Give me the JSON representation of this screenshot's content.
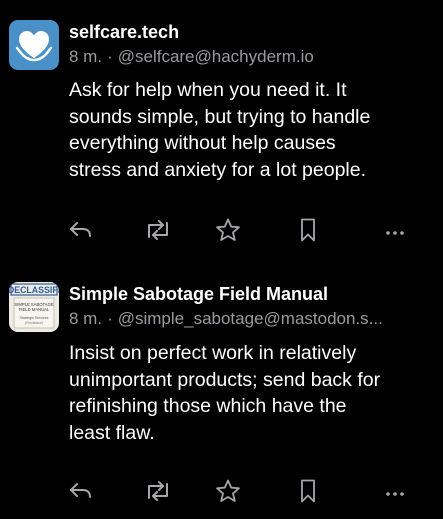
{
  "colors": {
    "background": "#000000",
    "text": "#ffffff",
    "meta_text": "#9a9aa0",
    "icon": "#a6a6ab",
    "selfcare_avatar_bg": "#4a90c8"
  },
  "posts": [
    {
      "display_name": "selfcare.tech",
      "time": "8 m.",
      "separator": "·",
      "handle": "@selfcare@hachyderm.io",
      "content_lines": [
        "Ask for help when you need it. It",
        "sounds simple, but trying to handle",
        "everything without help causes",
        "stress and anxiety for a lot people."
      ],
      "avatar_icon": "heart-hands-icon"
    },
    {
      "display_name": "Simple Sabotage Field Manual",
      "time": "8 m.",
      "separator": "·",
      "handle": "@simple_sabotage@mastodon.s...",
      "content_lines": [
        "Insist on perfect work in relatively",
        "unimportant products; send back for",
        "refinishing those which have the",
        "least flaw."
      ],
      "avatar_stamp": "DECLASSIFI",
      "avatar_doc_lines": [
        "SIMPLE SABOTAGE",
        "FIELD MANUAL",
        "Strategic Services"
      ],
      "avatar_doc_note": "(Provisional)"
    }
  ],
  "actions": {
    "reply_icon": "reply-icon",
    "boost_icon": "boost-icon",
    "favourite_icon": "star-icon",
    "bookmark_icon": "bookmark-icon",
    "more_icon": "more-icon",
    "more_glyph": "···"
  }
}
